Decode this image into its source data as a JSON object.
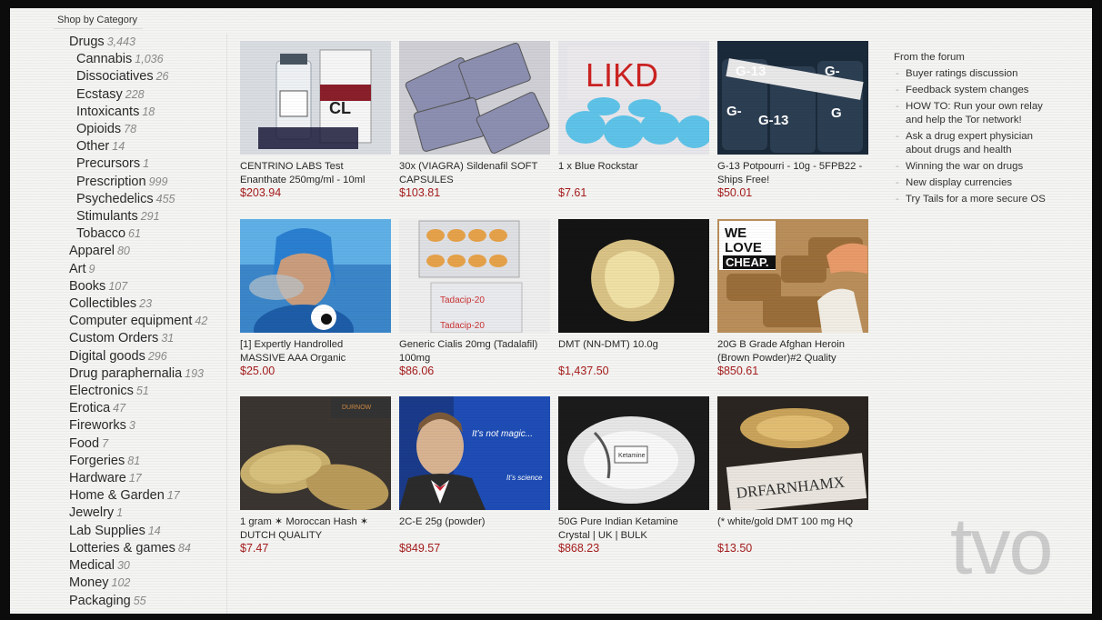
{
  "shop_by_category": "Shop by Category",
  "categories": [
    {
      "name": "Drugs",
      "count": "3,443",
      "level": "top"
    },
    {
      "name": "Cannabis",
      "count": "1,036",
      "level": "sub"
    },
    {
      "name": "Dissociatives",
      "count": "26",
      "level": "sub"
    },
    {
      "name": "Ecstasy",
      "count": "228",
      "level": "sub"
    },
    {
      "name": "Intoxicants",
      "count": "18",
      "level": "sub"
    },
    {
      "name": "Opioids",
      "count": "78",
      "level": "sub"
    },
    {
      "name": "Other",
      "count": "14",
      "level": "sub"
    },
    {
      "name": "Precursors",
      "count": "1",
      "level": "sub"
    },
    {
      "name": "Prescription",
      "count": "999",
      "level": "sub"
    },
    {
      "name": "Psychedelics",
      "count": "455",
      "level": "sub"
    },
    {
      "name": "Stimulants",
      "count": "291",
      "level": "sub"
    },
    {
      "name": "Tobacco",
      "count": "61",
      "level": "sub"
    },
    {
      "name": "Apparel",
      "count": "80",
      "level": "top"
    },
    {
      "name": "Art",
      "count": "9",
      "level": "top"
    },
    {
      "name": "Books",
      "count": "107",
      "level": "top"
    },
    {
      "name": "Collectibles",
      "count": "23",
      "level": "top"
    },
    {
      "name": "Computer equipment",
      "count": "42",
      "level": "top"
    },
    {
      "name": "Custom Orders",
      "count": "31",
      "level": "top"
    },
    {
      "name": "Digital goods",
      "count": "296",
      "level": "top"
    },
    {
      "name": "Drug paraphernalia",
      "count": "193",
      "level": "top"
    },
    {
      "name": "Electronics",
      "count": "51",
      "level": "top"
    },
    {
      "name": "Erotica",
      "count": "47",
      "level": "top"
    },
    {
      "name": "Fireworks",
      "count": "3",
      "level": "top"
    },
    {
      "name": "Food",
      "count": "7",
      "level": "top"
    },
    {
      "name": "Forgeries",
      "count": "81",
      "level": "top"
    },
    {
      "name": "Hardware",
      "count": "17",
      "level": "top"
    },
    {
      "name": "Home & Garden",
      "count": "17",
      "level": "top"
    },
    {
      "name": "Jewelry",
      "count": "1",
      "level": "top"
    },
    {
      "name": "Lab Supplies",
      "count": "14",
      "level": "top"
    },
    {
      "name": "Lotteries & games",
      "count": "84",
      "level": "top"
    },
    {
      "name": "Medical",
      "count": "30",
      "level": "top"
    },
    {
      "name": "Money",
      "count": "102",
      "level": "top"
    },
    {
      "name": "Packaging",
      "count": "55",
      "level": "top"
    }
  ],
  "listings": [
    {
      "title": "CENTRINO LABS Test Enanthate 250mg/ml - 10ml",
      "price": "$203.94",
      "image_text": "CL"
    },
    {
      "title": "30x (VIAGRA) Sildenafil SOFT CAPSULES",
      "price": "$103.81",
      "image_text": ""
    },
    {
      "title": "1 x Blue Rockstar",
      "price": "$7.61",
      "image_text": "LIKD"
    },
    {
      "title": "G-13 Potpourri - 10g - 5FPB22 - Ships Free!",
      "price": "$50.01",
      "image_text": "G-13"
    },
    {
      "title": "[1] Expertly Handrolled MASSIVE AAA Organic",
      "price": "$25.00",
      "image_text": ""
    },
    {
      "title": "Generic Cialis 20mg (Tadalafil) 100mg",
      "price": "$86.06",
      "image_text": "Tadacip-20"
    },
    {
      "title": "DMT (NN-DMT) 10.0g",
      "price": "$1,437.50",
      "image_text": ""
    },
    {
      "title": "20G B Grade Afghan Heroin (Brown Powder)#2 Quality",
      "price": "$850.61",
      "image_text": "WE LOVE CHEAP."
    },
    {
      "title": "1 gram ✶ Moroccan Hash ✶ DUTCH QUALITY",
      "price": "$7.47",
      "image_text": ""
    },
    {
      "title": "2C-E 25g (powder)",
      "price": "$849.57",
      "image_text": "It's not magic..."
    },
    {
      "title": "50G Pure Indian Ketamine Crystal | UK | BULK",
      "price": "$868.23",
      "image_text": ""
    },
    {
      "title": "(* white/gold DMT 100 mg HQ",
      "price": "$13.50",
      "image_text": "DRFARNHAMX"
    }
  ],
  "forum": {
    "heading": "From the forum",
    "items": [
      "Buyer ratings discussion",
      "Feedback system changes",
      "HOW TO: Run your own relay and help the Tor network!",
      "Ask a drug expert physician about drugs and health",
      "Winning the war on drugs",
      "New display currencies",
      "Try Tails for a more secure OS"
    ]
  },
  "watermark": "tvo",
  "colors": {
    "price": "#a51c1c",
    "background": "#f4f4f2",
    "count": "#8a8a8a"
  }
}
